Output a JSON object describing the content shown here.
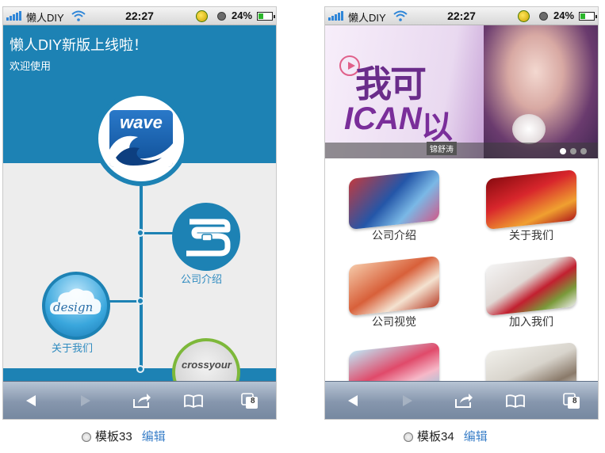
{
  "status_bar": {
    "carrier": "懒人DIY",
    "time": "22:27",
    "battery": "24%"
  },
  "template33": {
    "title": "懒人DIY新版上线啦！",
    "subtitle": "欢迎使用",
    "logo_text": "wave",
    "node_company_label": "公司介绍",
    "node_about_label": "关于我们",
    "design_text": "design",
    "cross_text": "crossyour"
  },
  "template34": {
    "banner_text_top": "我可",
    "banner_text_ican": "ICAN",
    "banner_text_yi": "以",
    "banner_signature": "锦舒涛",
    "tiles": [
      {
        "label": "公司介绍"
      },
      {
        "label": "关于我们"
      },
      {
        "label": "公司视觉"
      },
      {
        "label": "加入我们"
      }
    ]
  },
  "captions": [
    {
      "name": "模板33",
      "edit": "编辑"
    },
    {
      "name": "模板34",
      "edit": "编辑"
    }
  ],
  "toolbar": {
    "tab_count": "8"
  }
}
